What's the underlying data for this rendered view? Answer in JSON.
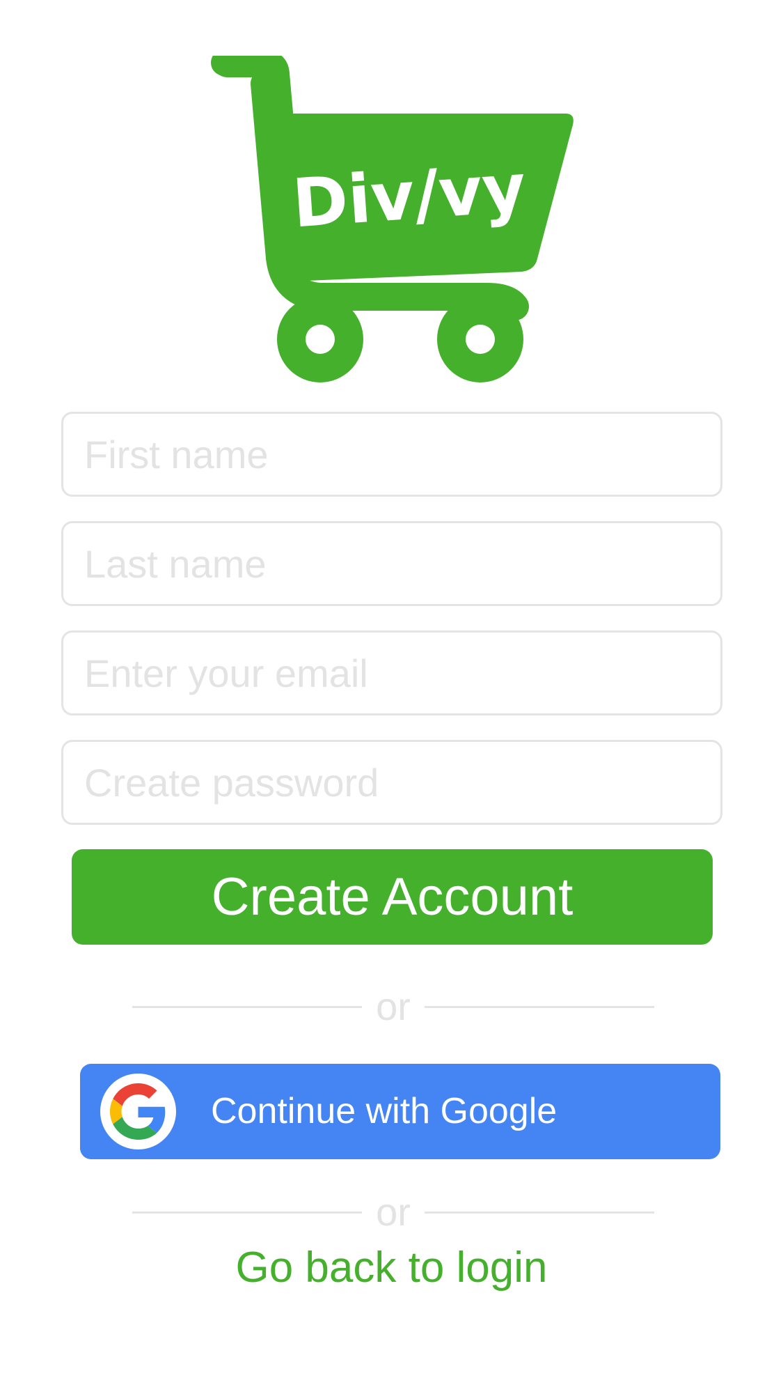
{
  "brand": {
    "logo_text": "Div/vy",
    "accent_color": "#45b02c"
  },
  "form": {
    "first_name": {
      "placeholder": "First name",
      "value": ""
    },
    "last_name": {
      "placeholder": "Last name",
      "value": ""
    },
    "email": {
      "placeholder": "Enter your email",
      "value": ""
    },
    "password": {
      "placeholder": "Create password",
      "value": ""
    }
  },
  "create_button": {
    "label": "Create Account",
    "color": "#45b02c"
  },
  "dividers": [
    {
      "label": "or"
    },
    {
      "label": "or"
    }
  ],
  "google_button": {
    "label": "Continue with Google",
    "color": "#4485f3",
    "icon": "google-g-icon"
  },
  "back_link": {
    "label": "Go back to login"
  }
}
